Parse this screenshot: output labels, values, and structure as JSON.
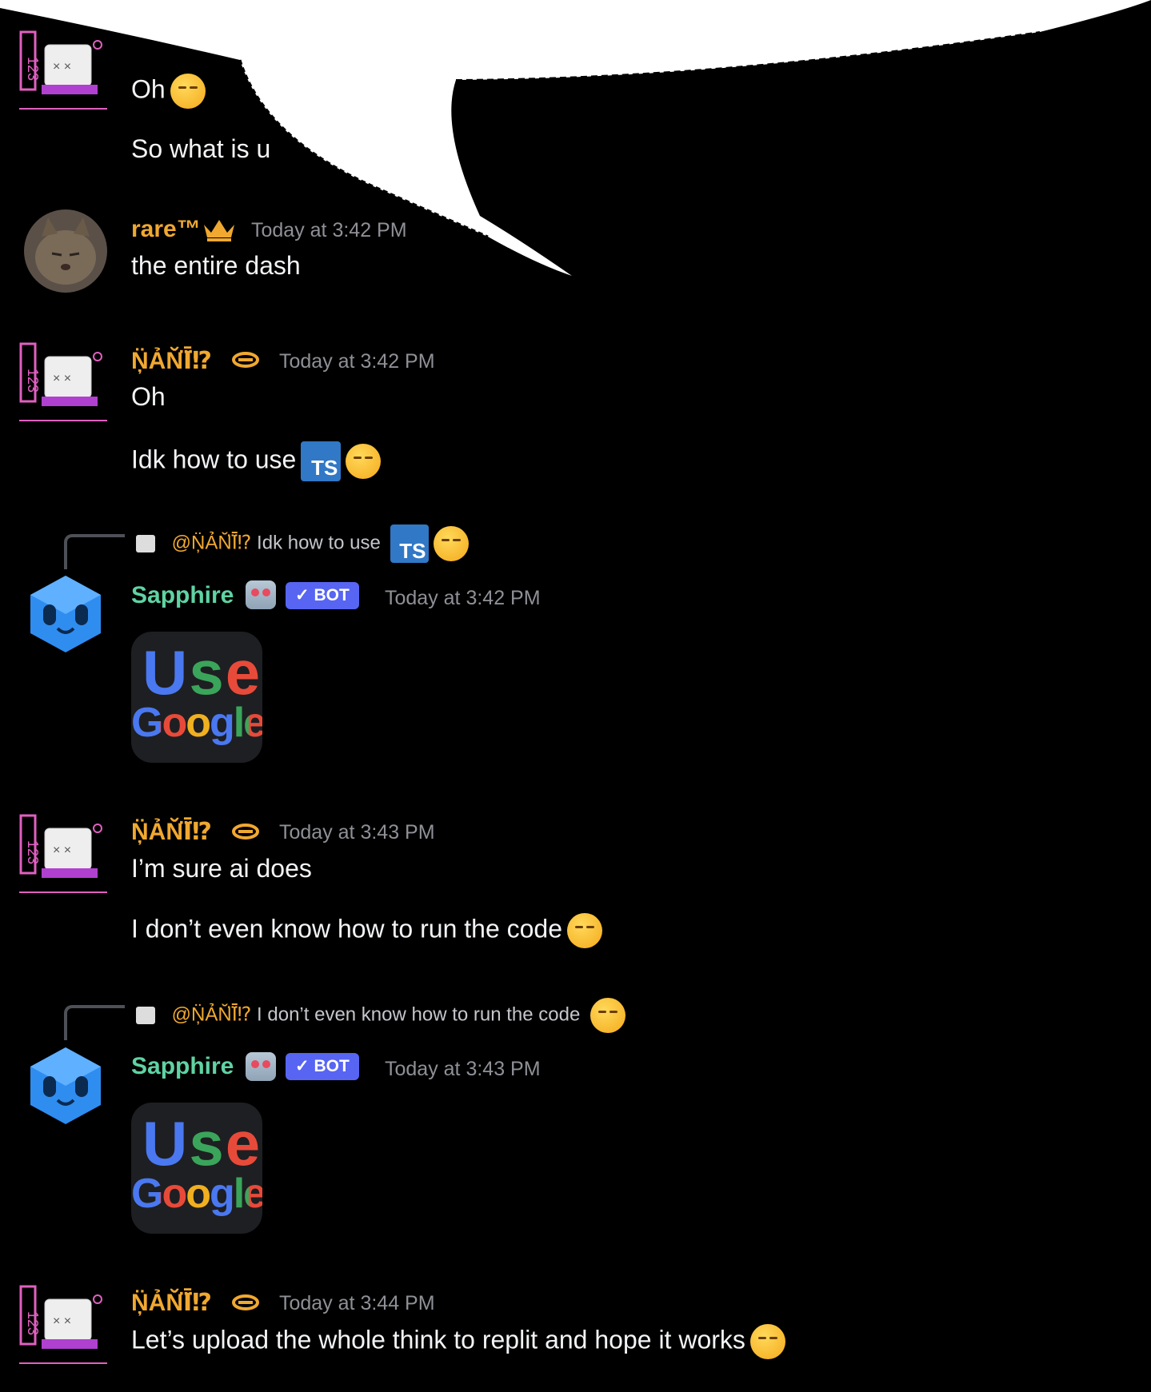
{
  "users": {
    "nani": {
      "name": "Ņ̈ẢŇ̆Ī⃛⁉",
      "color": "#f0a830"
    },
    "rare": {
      "name": "rare™",
      "color": "#f0a830"
    },
    "sapphire": {
      "name": "Sapphire",
      "color": "#5fd3a3",
      "badge": "BOT"
    }
  },
  "messages": [
    {
      "id": "m1",
      "author": "nani",
      "lines": [
        "Oh",
        "So what is u"
      ],
      "note": "partially hidden under speech bubble"
    },
    {
      "id": "m2",
      "author": "rare",
      "time": "Today at 3:42 PM",
      "lines": [
        "the entire dash"
      ]
    },
    {
      "id": "m3",
      "author": "nani",
      "time": "Today at 3:42 PM",
      "lines": [
        "Oh",
        "Idk how to use"
      ]
    },
    {
      "id": "m4",
      "author": "sapphire",
      "time": "Today at 3:42 PM",
      "reply": {
        "mention": "@Ņ̈ẢŇ̆Ī⃛⁉",
        "text": "Idk how to use"
      },
      "image": {
        "line1": "Use",
        "line2": "Google"
      }
    },
    {
      "id": "m5",
      "author": "nani",
      "time": "Today at 3:43 PM",
      "lines": [
        "I’m sure ai does",
        "I don’t even know how to run the code"
      ]
    },
    {
      "id": "m6",
      "author": "sapphire",
      "time": "Today at 3:43 PM",
      "reply": {
        "mention": "@Ņ̈ẢŇ̆Ī⃛⁉",
        "text": "I don’t even know how to run the code"
      },
      "image": {
        "line1": "Use",
        "line2": "Google"
      }
    },
    {
      "id": "m7",
      "author": "nani",
      "time": "Today at 3:44 PM",
      "lines": [
        "Let’s upload the whole think to replit and hope it works"
      ]
    }
  ],
  "icons": {
    "ts": "TS"
  }
}
